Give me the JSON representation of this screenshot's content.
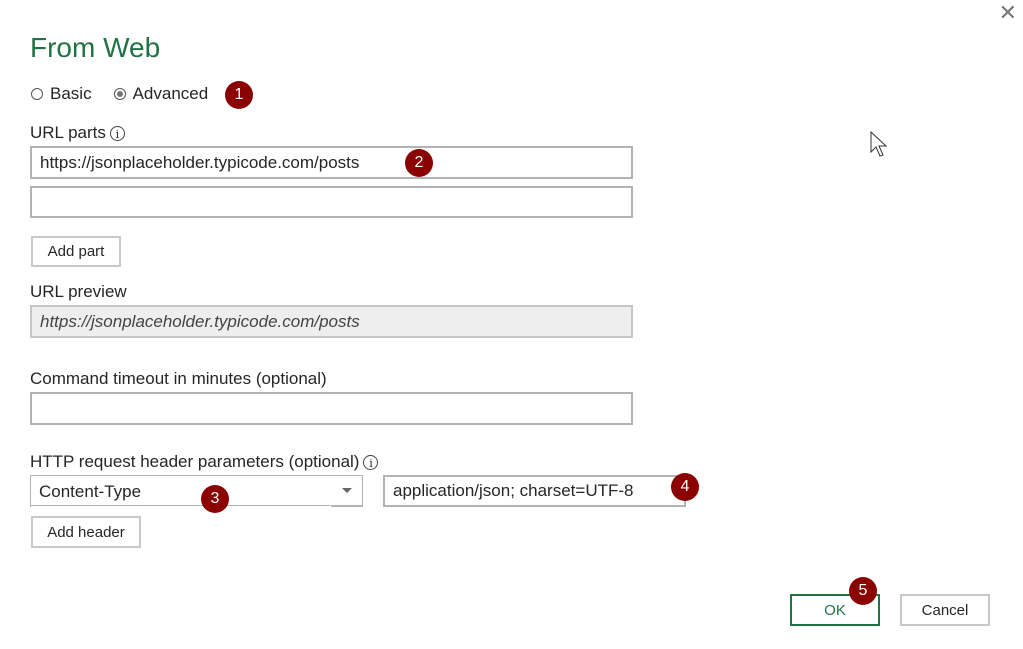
{
  "dialog": {
    "title": "From Web",
    "close_icon": "close-icon"
  },
  "mode": {
    "options": [
      {
        "label": "Basic",
        "selected": false
      },
      {
        "label": "Advanced",
        "selected": true
      }
    ]
  },
  "url_parts": {
    "label": "URL parts",
    "info_icon": "i",
    "parts": [
      {
        "value": "https://jsonplaceholder.typicode.com/posts",
        "placeholder": ""
      },
      {
        "value": "",
        "placeholder": ""
      }
    ],
    "add_part_label": "Add part"
  },
  "url_preview": {
    "label": "URL preview",
    "value": "https://jsonplaceholder.typicode.com/posts"
  },
  "command_timeout": {
    "label": "Command timeout in minutes (optional)",
    "value": ""
  },
  "http_headers": {
    "label": "HTTP request header parameters (optional)",
    "info_icon": "i",
    "header_name": "Content-Type",
    "header_value": "application/json; charset=UTF-8",
    "add_header_label": "Add header"
  },
  "footer": {
    "ok_label": "OK",
    "cancel_label": "Cancel"
  },
  "badges": [
    "1",
    "2",
    "3",
    "4",
    "5"
  ],
  "colors": {
    "accent": "#217346",
    "badge": "#8b0000"
  }
}
